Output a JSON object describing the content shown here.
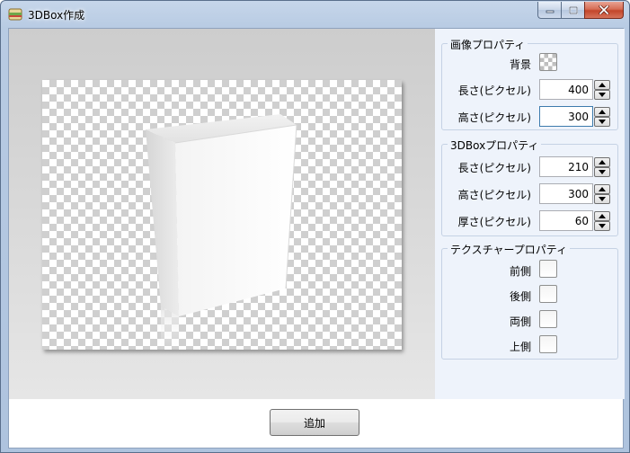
{
  "window": {
    "title": "3DBox作成",
    "icon": "app-box-icon"
  },
  "caption": {
    "minimize_icon": "minimize-icon",
    "maximize_icon": "maximize-icon",
    "close_icon": "close-icon"
  },
  "image_props": {
    "title": "画像プロパティ",
    "background_label": "背景",
    "length_label": "長さ(ピクセル)",
    "length_value": "400",
    "height_label": "高さ(ピクセル)",
    "height_value": "300"
  },
  "box_props": {
    "title": "3DBoxプロパティ",
    "length_label": "長さ(ピクセル)",
    "length_value": "210",
    "height_label": "高さ(ピクセル)",
    "height_value": "300",
    "thickness_label": "厚さ(ピクセル)",
    "thickness_value": "60"
  },
  "texture_props": {
    "title": "テクスチャープロパティ",
    "front_label": "前側",
    "back_label": "後側",
    "both_label": "両側",
    "top_label": "上側"
  },
  "footer": {
    "add_label": "追加"
  },
  "colors": {
    "panel_bg": "#eef3fb",
    "group_border": "#c5d2e4",
    "close_red": "#c3462b"
  }
}
